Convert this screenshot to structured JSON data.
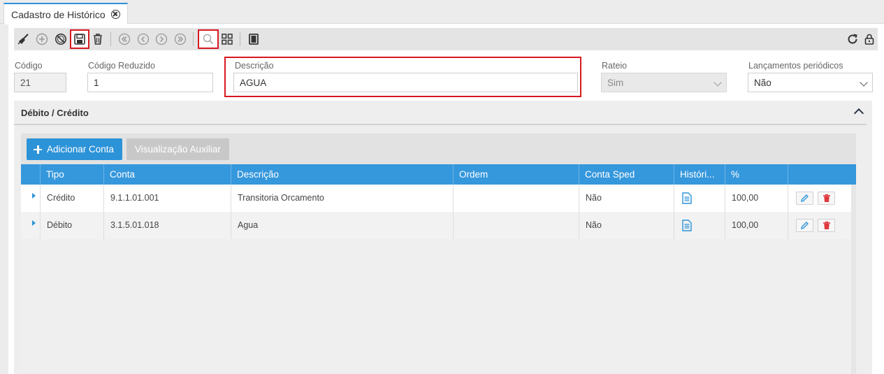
{
  "tab": {
    "title": "Cadastro de Histórico"
  },
  "form": {
    "codigo": {
      "label": "Código",
      "value": "21"
    },
    "codigo_reduzido": {
      "label": "Código Reduzido",
      "value": "1"
    },
    "descricao": {
      "label": "Descrição",
      "value": "AGUA"
    },
    "rateio": {
      "label": "Rateio",
      "value": "Sim"
    },
    "lancamentos": {
      "label": "Lançamentos periódicos",
      "value": "Não"
    }
  },
  "section": {
    "title": "Débito / Crédito",
    "add_button": "Adicionar Conta",
    "aux_button": "Visualização Auxiliar"
  },
  "grid": {
    "columns": [
      "Tipo",
      "Conta",
      "Descrição",
      "Ordem",
      "Conta Sped",
      "Históri...",
      "%"
    ],
    "rows": [
      {
        "tipo": "Crédito",
        "conta": "9.1.1.01.001",
        "descricao": "Transitoria Orcamento",
        "ordem": "",
        "conta_sped": "Não",
        "percent": "100,00"
      },
      {
        "tipo": "Débito",
        "conta": "3.1.5.01.018",
        "descricao": "Agua",
        "ordem": "",
        "conta_sped": "Não",
        "percent": "100,00"
      }
    ]
  },
  "colors": {
    "accent": "#2d93d8",
    "highlight": "#d71920",
    "delete": "#e0393e"
  }
}
